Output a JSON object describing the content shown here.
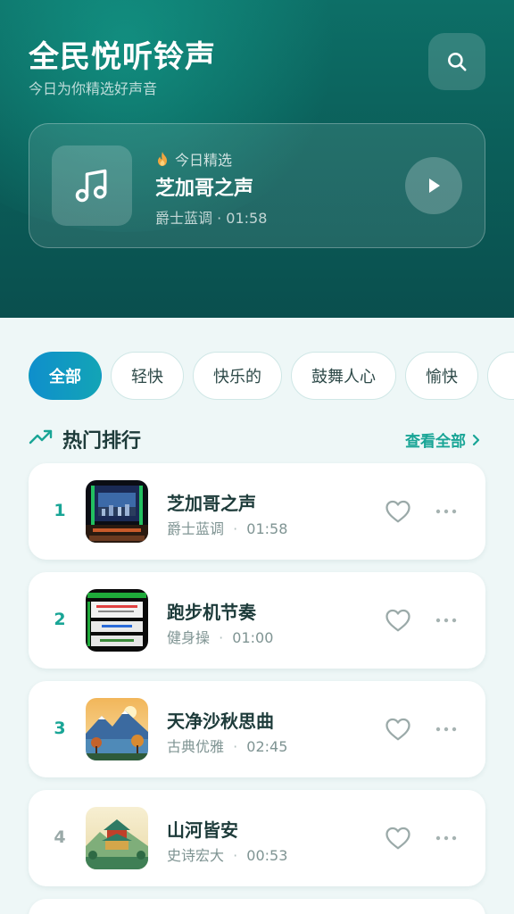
{
  "header": {
    "title": "全民悦听铃声",
    "subtitle": "今日为你精选好声音",
    "search_icon": "search-icon"
  },
  "featured": {
    "tag": "今日精选",
    "tag_icon": "fire-icon",
    "title": "芝加哥之声",
    "meta": "爵士蓝调 · 01:58",
    "art_icon": "music-note-icon",
    "play_icon": "play-icon"
  },
  "tabs": [
    "全部",
    "轻快",
    "快乐的",
    "鼓舞人心",
    "愉快"
  ],
  "active_tab": "全部",
  "section": {
    "title": "热门排行",
    "icon": "trending-up-icon",
    "view_all": "查看全部"
  },
  "songs": [
    {
      "rank": "1",
      "title": "芝加哥之声",
      "genre": "爵士蓝调",
      "sep": "·",
      "duration": "01:58"
    },
    {
      "rank": "2",
      "title": "跑步机节奏",
      "genre": "健身操",
      "sep": "·",
      "duration": "01:00"
    },
    {
      "rank": "3",
      "title": "天净沙秋思曲",
      "genre": "古典优雅",
      "sep": "·",
      "duration": "02:45"
    },
    {
      "rank": "4",
      "title": "山河皆安",
      "genre": "史诗宏大",
      "sep": "·",
      "duration": "00:53"
    }
  ],
  "colors": {
    "accent": "#19a596",
    "header_top": "#0d6f67",
    "header_bottom": "#0a4f4e",
    "tab_active_start": "#0f8fcc",
    "tab_active_end": "#13a4b6",
    "background": "#eef7f7"
  }
}
